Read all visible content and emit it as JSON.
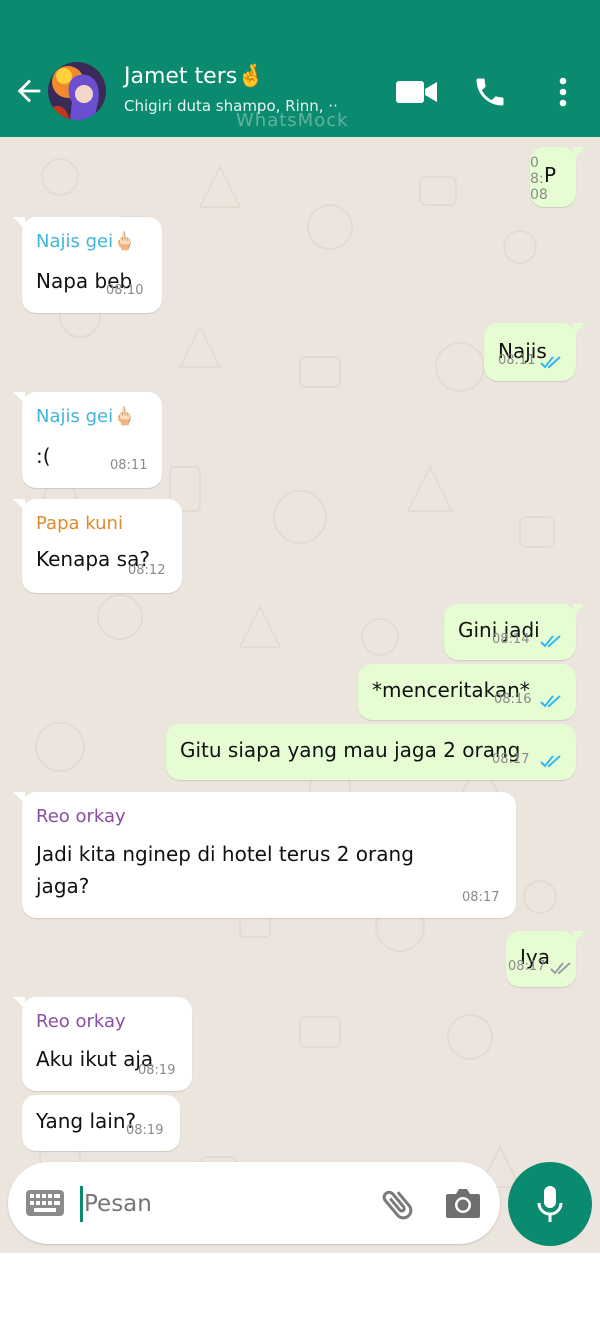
{
  "header": {
    "title": "Jamet ters🤞",
    "subtitle": "Chigiri duta shampo, Rinn, ··",
    "watermark": "WhatsMock",
    "icons": [
      "back-arrow-icon",
      "video-call-icon",
      "phone-icon",
      "more-vert-icon"
    ],
    "color": "#0a8a6f"
  },
  "messages": [
    {
      "dir": "out",
      "text": "P",
      "time": "08:08",
      "read": false
    },
    {
      "dir": "in",
      "sender": "Najis gei🖕🏻",
      "sender_color": "#3fb6d8",
      "text": "Napa beb",
      "time": "08:10"
    },
    {
      "dir": "out",
      "text": "Najis",
      "time": "08:11",
      "read": true
    },
    {
      "dir": "in",
      "sender": "Najis gei🖕🏻",
      "sender_color": "#3fb6d8",
      "text": ":(",
      "time": "08:11"
    },
    {
      "dir": "in",
      "sender": "Papa kuni",
      "sender_color": "#e08a2c",
      "text": "Kenapa sa?",
      "time": "08:12"
    },
    {
      "dir": "out",
      "text": "Gini jadi",
      "time": "08:14",
      "read": true
    },
    {
      "dir": "out",
      "text": "*menceritakan*",
      "time": "08:16",
      "read": true
    },
    {
      "dir": "out",
      "text": "Gitu siapa yang mau jaga 2 orang",
      "time": "08:17",
      "read": true
    },
    {
      "dir": "in",
      "sender": "Reo orkay",
      "sender_color": "#8a4fa0",
      "text": "Jadi kita nginep di hotel terus 2 orang",
      "text2": "jaga?",
      "time": "08:17"
    },
    {
      "dir": "out",
      "text": "Iya",
      "time": "08:17",
      "read": false
    },
    {
      "dir": "in",
      "sender": "Reo orkay",
      "sender_color": "#8a4fa0",
      "text": "Aku ikut aja",
      "time": "08:19"
    },
    {
      "dir": "in",
      "text": "Yang lain?",
      "time": "08:19"
    }
  ],
  "composer": {
    "placeholder": "Pesan",
    "icons": [
      "keyboard-icon",
      "attach-icon",
      "camera-icon",
      "mic-icon"
    ]
  },
  "colors": {
    "tick_read": "#34b7f1",
    "tick_unread": "#9aa0a0",
    "bubble_out": "#e6fdd3"
  }
}
